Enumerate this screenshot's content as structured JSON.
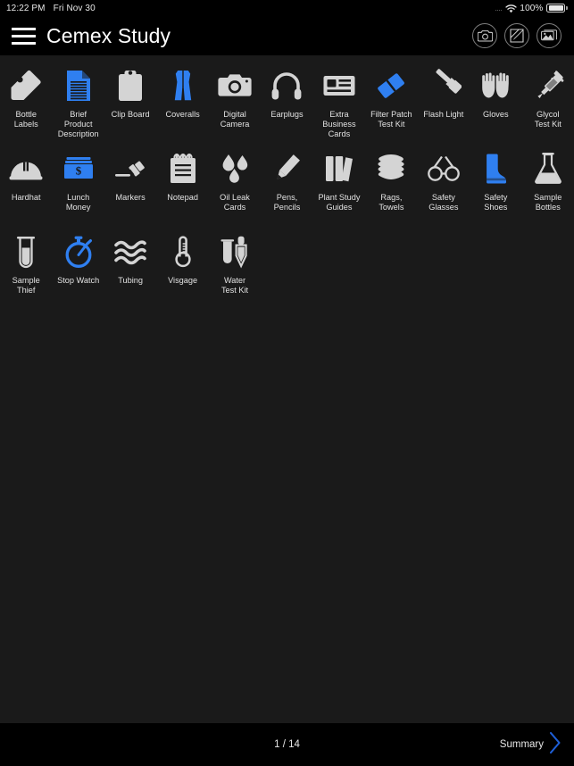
{
  "status_bar": {
    "time": "12:22 PM",
    "date": "Fri Nov 30",
    "signal_dots": "....",
    "wifi_icon": "wifi-icon",
    "battery_percent": "100%",
    "battery_icon": "battery-full-icon"
  },
  "header": {
    "menu_icon": "hamburger-menu-icon",
    "title": "Cemex Study",
    "actions": [
      {
        "name": "camera-button",
        "icon": "camera-icon"
      },
      {
        "name": "compose-button",
        "icon": "compose-pencil-icon"
      },
      {
        "name": "gallery-button",
        "icon": "photo-gallery-icon"
      }
    ]
  },
  "theme": {
    "background": "#000000",
    "content_background": "#1a1a1a",
    "accent_blue": "#2f7ff0",
    "icon_gray": "#d4d4d4",
    "text": "#e2e2e2"
  },
  "grid": {
    "columns": 11,
    "items": [
      {
        "label": "Bottle\nLabels",
        "icon": "tag-icon",
        "selected": false
      },
      {
        "label": "Brief\nProduct\nDescription",
        "icon": "document-icon",
        "selected": true
      },
      {
        "label": "Clip Board",
        "icon": "clipboard-icon",
        "selected": false
      },
      {
        "label": "Coveralls",
        "icon": "coveralls-icon",
        "selected": true
      },
      {
        "label": "Digital\nCamera",
        "icon": "camera-icon",
        "selected": false
      },
      {
        "label": "Earplugs",
        "icon": "earplugs-icon",
        "selected": false
      },
      {
        "label": "Extra\nBusiness\nCards",
        "icon": "business-card-icon",
        "selected": false
      },
      {
        "label": "Filter Patch\nTest Kit",
        "icon": "filter-patch-icon",
        "selected": true
      },
      {
        "label": "Flash Light",
        "icon": "flashlight-icon",
        "selected": false
      },
      {
        "label": "Gloves",
        "icon": "gloves-icon",
        "selected": false
      },
      {
        "label": "Glycol\nTest Kit",
        "icon": "syringe-icon",
        "selected": false
      },
      {
        "label": "Hardhat",
        "icon": "hardhat-icon",
        "selected": false
      },
      {
        "label": "Lunch\nMoney",
        "icon": "money-icon",
        "selected": true
      },
      {
        "label": "Markers",
        "icon": "marker-icon",
        "selected": false
      },
      {
        "label": "Notepad",
        "icon": "notepad-icon",
        "selected": false
      },
      {
        "label": "Oil Leak\nCards",
        "icon": "oil-drops-icon",
        "selected": false
      },
      {
        "label": "Pens,\nPencils",
        "icon": "pencil-icon",
        "selected": false
      },
      {
        "label": "Plant Study\nGuides",
        "icon": "books-icon",
        "selected": false
      },
      {
        "label": "Rags,\nTowels",
        "icon": "rag-icon",
        "selected": false
      },
      {
        "label": "Safety\nGlasses",
        "icon": "glasses-icon",
        "selected": false
      },
      {
        "label": "Safety\nShoes",
        "icon": "boot-icon",
        "selected": true
      },
      {
        "label": "Sample\nBottles",
        "icon": "flask-icon",
        "selected": false
      },
      {
        "label": "Sample\nThief",
        "icon": "test-tube-icon",
        "selected": false
      },
      {
        "label": "Stop Watch",
        "icon": "stopwatch-icon",
        "selected": true
      },
      {
        "label": "Tubing",
        "icon": "waves-icon",
        "selected": false
      },
      {
        "label": "Visgage",
        "icon": "thermometer-icon",
        "selected": false
      },
      {
        "label": "Water\nTest Kit",
        "icon": "water-test-kit-icon",
        "selected": false
      }
    ]
  },
  "footer": {
    "pager": "1 / 14",
    "next_label": "Summary",
    "next_icon": "chevron-right-icon"
  }
}
